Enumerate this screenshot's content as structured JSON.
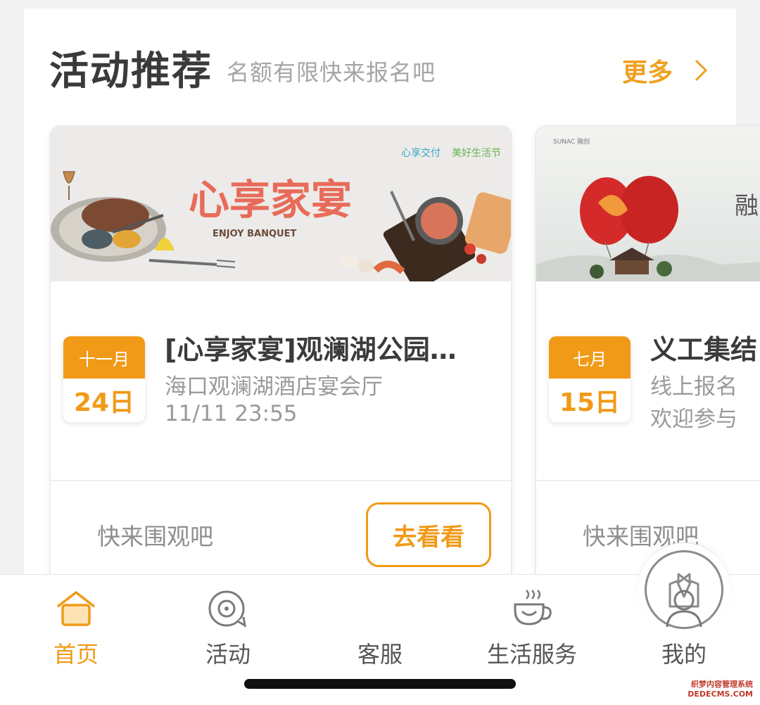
{
  "section": {
    "title": "活动推荐",
    "subtitle": "名额有限快来报名吧",
    "more_label": "更多"
  },
  "cards": [
    {
      "banner": {
        "brand_left": "心享交付",
        "brand_right": "美好生活节",
        "headline": "心享家宴",
        "headline_en": "ENJOY BANQUET"
      },
      "month": "十一月",
      "day": "24日",
      "title": "[心享家宴]观澜湖公园…",
      "venue": "海口观澜湖酒店宴会厅",
      "time": "11/11 23:55",
      "footer": "快来围观吧",
      "button": "去看看"
    },
    {
      "banner": {
        "brand": "SUNAC 融创",
        "headline": "融"
      },
      "month": "七月",
      "day": "15日",
      "title": "义工集结",
      "venue": "线上报名",
      "time": "欢迎参与",
      "footer": "快来围观吧"
    }
  ],
  "tabs": [
    {
      "label": "首页",
      "icon": "home-icon",
      "active": true
    },
    {
      "label": "活动",
      "icon": "activity-icon",
      "active": false
    },
    {
      "label": "客服",
      "icon": "customer-service-icon",
      "active": false
    },
    {
      "label": "生活服务",
      "icon": "coffee-cup-icon",
      "active": false
    },
    {
      "label": "我的",
      "icon": "user-icon",
      "active": false
    }
  ],
  "watermark": {
    "line1": "织梦内容管理系统",
    "line2": "DEDECMS.COM"
  },
  "colors": {
    "accent": "#f19a17",
    "title": "#3a3a3a",
    "muted": "#9a9a9a"
  }
}
